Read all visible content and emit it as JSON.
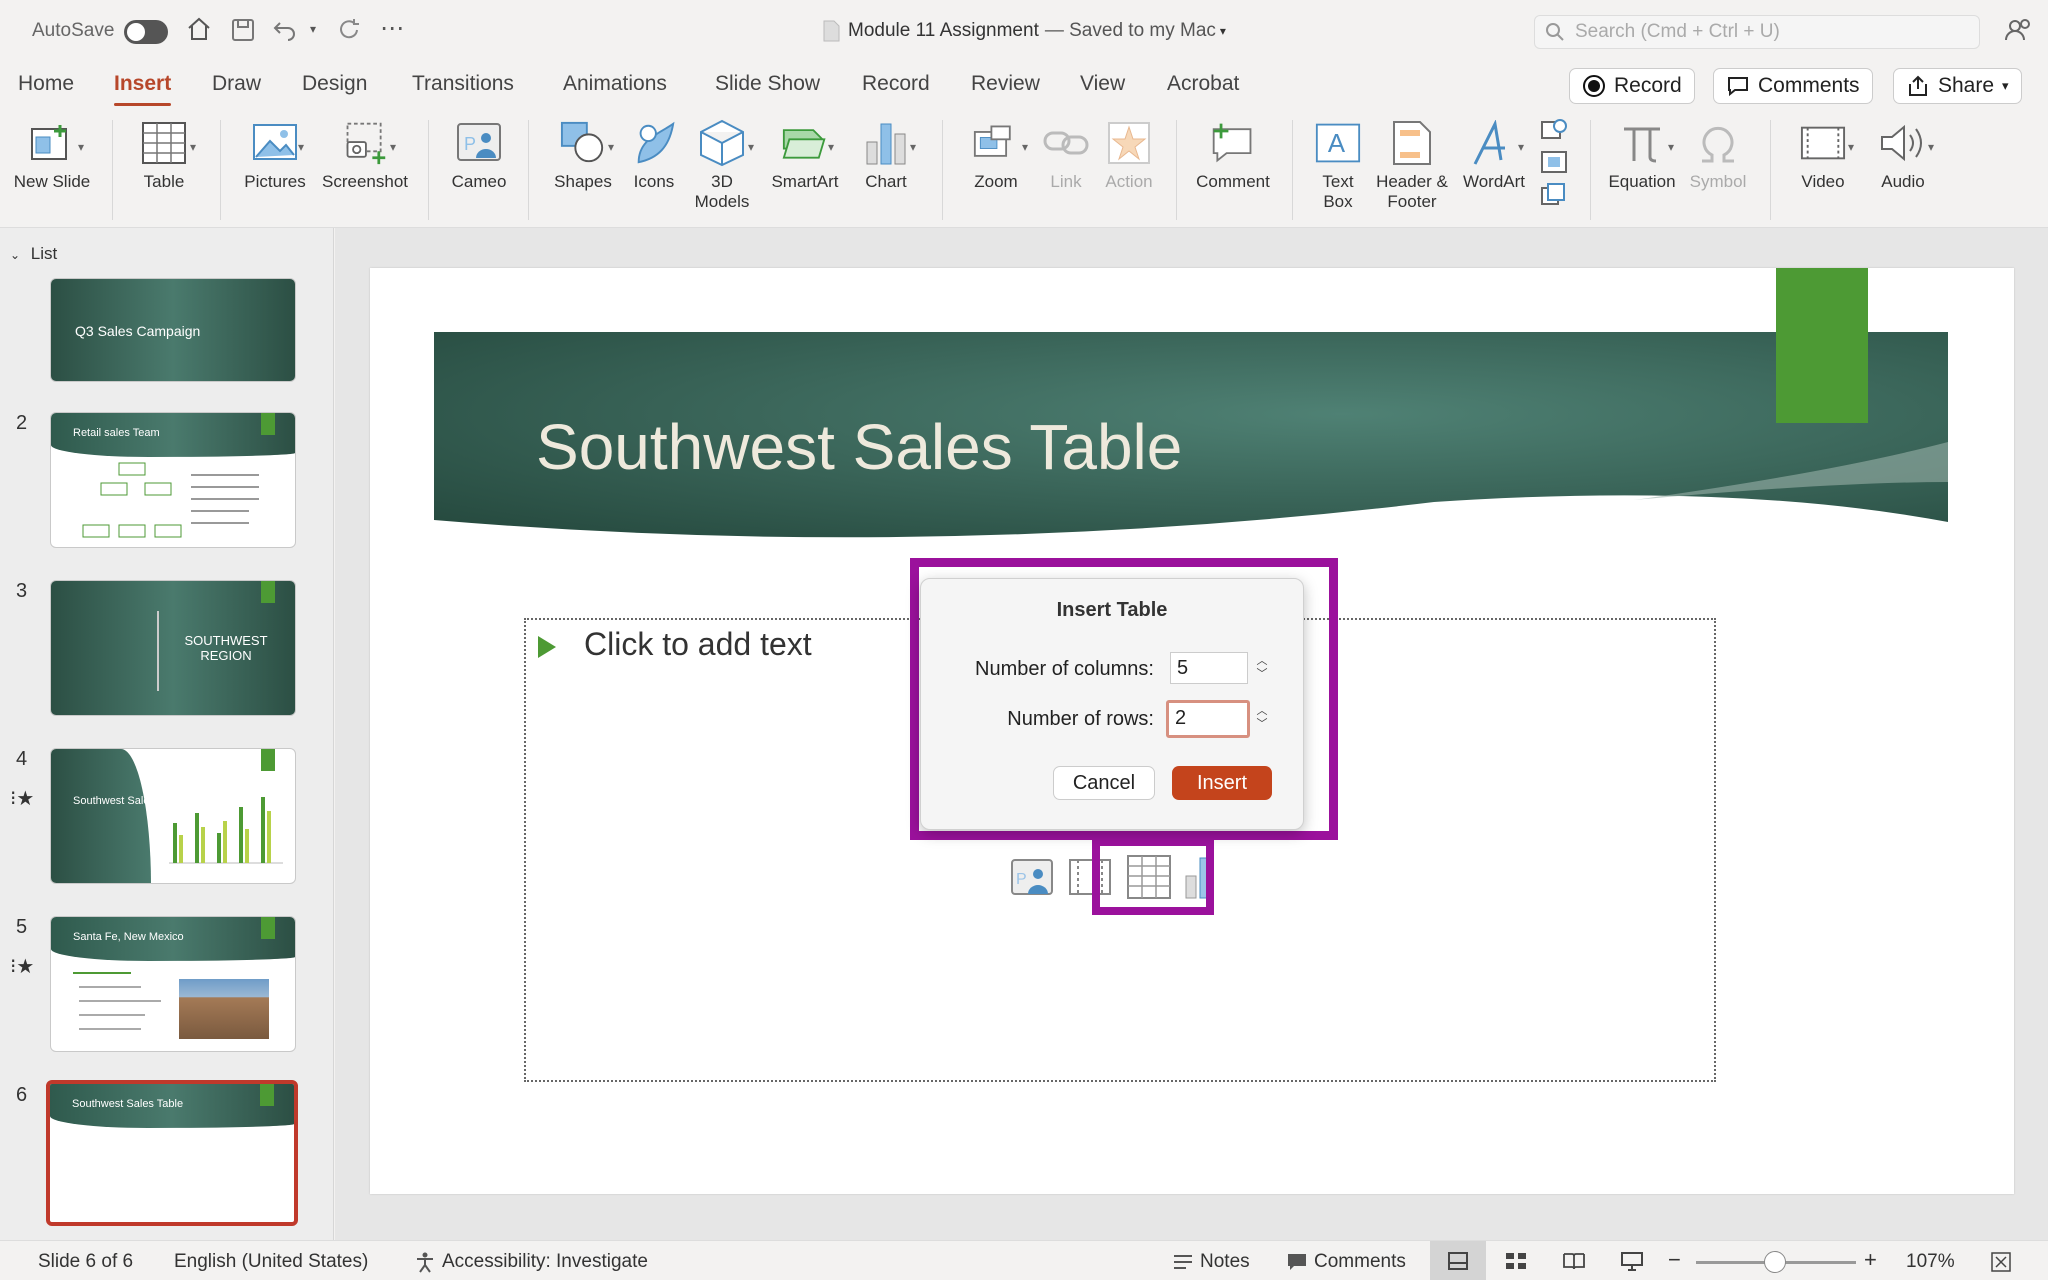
{
  "titlebar": {
    "autosave_label": "AutoSave",
    "doc_name": "Module 11 Assignment",
    "save_status": "— Saved to my Mac",
    "search_placeholder": "Search (Cmd + Ctrl + U)"
  },
  "tabs": [
    "Home",
    "Insert",
    "Draw",
    "Design",
    "Transitions",
    "Animations",
    "Slide Show",
    "Record",
    "Review",
    "View",
    "Acrobat"
  ],
  "top_buttons": {
    "record": "Record",
    "comments": "Comments",
    "share": "Share"
  },
  "ribbon": {
    "new_slide": "New Slide",
    "table": "Table",
    "pictures": "Pictures",
    "screenshot": "Screenshot",
    "cameo": "Cameo",
    "shapes": "Shapes",
    "icons": "Icons",
    "models_3d": "3D Models",
    "smartart": "SmartArt",
    "chart": "Chart",
    "zoom": "Zoom",
    "link": "Link",
    "action": "Action",
    "comment": "Comment",
    "text_box": "Text Box",
    "header_footer": "Header & Footer",
    "wordart": "WordArt",
    "equation": "Equation",
    "symbol": "Symbol",
    "video": "Video",
    "audio": "Audio"
  },
  "sidebar": {
    "header": "List",
    "slides": [
      {
        "num": "",
        "title": "Q3 Sales Campaign"
      },
      {
        "num": "2",
        "title": "Retail sales Team"
      },
      {
        "num": "3",
        "title": "SOUTHWEST REGION"
      },
      {
        "num": "4",
        "title": "Southwest Sales"
      },
      {
        "num": "5",
        "title": "Santa Fe, New Mexico"
      },
      {
        "num": "6",
        "title": "Southwest Sales Table"
      }
    ]
  },
  "slide": {
    "title": "Southwest Sales Table",
    "placeholder_text": "Click to add text"
  },
  "dialog": {
    "title": "Insert Table",
    "columns_label": "Number of columns:",
    "columns_value": "5",
    "rows_label": "Number of rows:",
    "rows_value": "2",
    "cancel": "Cancel",
    "insert": "Insert"
  },
  "statusbar": {
    "slide_pos": "Slide 6 of 6",
    "language": "English (United States)",
    "accessibility": "Accessibility: Investigate",
    "notes": "Notes",
    "comments": "Comments",
    "zoom": "107%"
  },
  "colors": {
    "accent": "#b7472a",
    "highlight": "#9b119c",
    "slide_green": "#4d9a34",
    "banner": "#2f5a4d"
  }
}
